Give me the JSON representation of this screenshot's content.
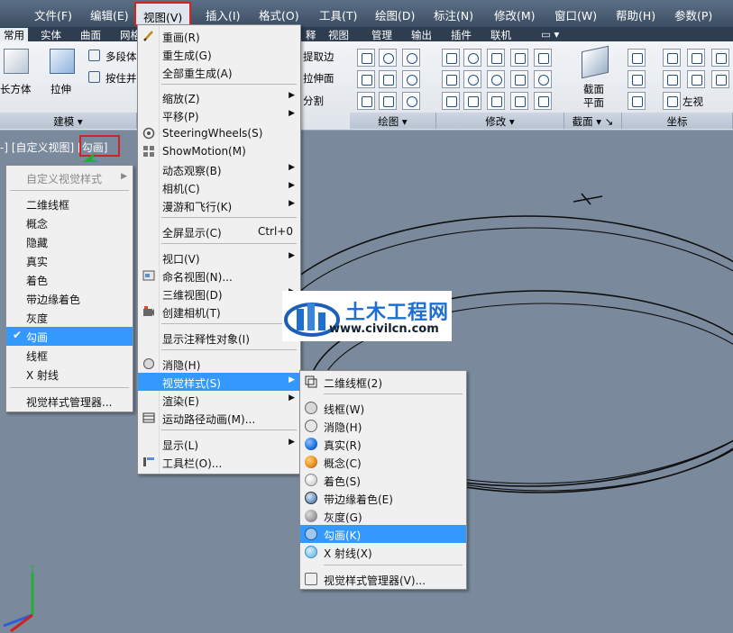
{
  "menubar": {
    "items": [
      "文件(F)",
      "编辑(E)",
      "视图(V)",
      "插入(I)",
      "格式(O)",
      "工具(T)",
      "绘图(D)",
      "标注(N)",
      "修改(M)",
      "窗口(W)",
      "帮助(H)",
      "参数(P)"
    ],
    "active_index": 2
  },
  "ribbon_tabs": {
    "items": [
      "常用",
      "实体",
      "曲面",
      "网格",
      "释",
      "视图",
      "管理",
      "输出",
      "插件",
      "联机"
    ],
    "active_index": 0
  },
  "ribbon": {
    "box_label": "长方体",
    "extrude_label": "拉伸",
    "polysolid_label": "多段体",
    "presspull_label": "按住并",
    "extract_edges_label": "提取边",
    "extrude_faces_label": "拉伸面",
    "split_label": "分割",
    "section_plane_label": "截面",
    "section_plane_label2": "平面",
    "left_view_label": "左视",
    "groups": [
      "建模 ▾",
      "绘图 ▾",
      "修改 ▾",
      "截面 ▾ ↘",
      "坐标"
    ]
  },
  "viewport": {
    "title_prefix": "-] [自定义视图] ",
    "current_style": "[勾画]"
  },
  "visual_style_dropdown": {
    "header": "自定义视觉样式",
    "items": [
      "二维线框",
      "概念",
      "隐藏",
      "真实",
      "着色",
      "带边缘着色",
      "灰度",
      "勾画",
      "线框",
      "X 射线"
    ],
    "selected_index": 7,
    "manager": "视觉样式管理器..."
  },
  "view_menu": {
    "items": [
      {
        "label": "重画(R)",
        "icon": "redraw-icon",
        "submenu": false
      },
      {
        "label": "重生成(G)",
        "icon": "",
        "submenu": false
      },
      {
        "label": "全部重生成(A)",
        "icon": "",
        "submenu": false
      },
      {
        "label": "缩放(Z)",
        "icon": "",
        "submenu": true
      },
      {
        "label": "平移(P)",
        "icon": "",
        "submenu": true
      },
      {
        "label": "SteeringWheels(S)",
        "icon": "steering-wheel-icon",
        "submenu": false
      },
      {
        "label": "ShowMotion(M)",
        "icon": "showmotion-icon",
        "submenu": false
      },
      {
        "label": "动态观察(B)",
        "icon": "",
        "submenu": true
      },
      {
        "label": "相机(C)",
        "icon": "",
        "submenu": true
      },
      {
        "label": "漫游和飞行(K)",
        "icon": "",
        "submenu": true
      },
      {
        "label": "全屏显示(C)",
        "icon": "",
        "submenu": false,
        "shortcut": "Ctrl+0"
      },
      {
        "label": "视口(V)",
        "icon": "",
        "submenu": true
      },
      {
        "label": "命名视图(N)...",
        "icon": "named-view-icon",
        "submenu": false
      },
      {
        "label": "三维视图(D)",
        "icon": "",
        "submenu": true
      },
      {
        "label": "创建相机(T)",
        "icon": "create-camera-icon",
        "submenu": false
      },
      {
        "label": "显示注释性对象(I)",
        "icon": "",
        "submenu": false
      },
      {
        "label": "消隐(H)",
        "icon": "hide-icon",
        "submenu": false
      },
      {
        "label": "视觉样式(S)",
        "icon": "",
        "submenu": true,
        "selected": true
      },
      {
        "label": "渲染(E)",
        "icon": "",
        "submenu": true
      },
      {
        "label": "运动路径动画(M)...",
        "icon": "motion-path-icon",
        "submenu": false
      },
      {
        "label": "显示(L)",
        "icon": "",
        "submenu": true
      },
      {
        "label": "工具栏(O)...",
        "icon": "toolbar-icon",
        "submenu": false
      }
    ]
  },
  "visual_style_submenu": {
    "items": [
      {
        "label": "二维线框(2)",
        "icon": "wireframe-2d-icon"
      },
      {
        "label": "线框(W)",
        "icon": "wireframe-icon",
        "color": "#d8d8d8"
      },
      {
        "label": "消隐(H)",
        "icon": "hidden-icon",
        "color": "#e6e6e6"
      },
      {
        "label": "真实(R)",
        "icon": "realistic-icon",
        "color": "#1f6fd8"
      },
      {
        "label": "概念(C)",
        "icon": "conceptual-icon",
        "color": "#e88a1a"
      },
      {
        "label": "着色(S)",
        "icon": "shaded-icon",
        "color": "#ececec"
      },
      {
        "label": "带边缘着色(E)",
        "icon": "shaded-edges-icon",
        "color": "#5f8fc0"
      },
      {
        "label": "灰度(G)",
        "icon": "shades-of-gray-icon",
        "color": "#8e8e8e"
      },
      {
        "label": "勾画(K)",
        "icon": "sketchy-icon",
        "color": "#9ec8ee",
        "selected": true
      },
      {
        "label": "X 射线(X)",
        "icon": "xray-icon",
        "color": "#7cc3ea"
      },
      {
        "label": "视觉样式管理器(V)...",
        "icon": "visual-style-manager-icon"
      }
    ]
  },
  "watermark": {
    "title": "土木工程网",
    "url": "www.civilcn.com"
  },
  "colors": {
    "viewport_bg": "#7a8a9c",
    "selection": "#3399ff",
    "highlight_box": "#d32222"
  }
}
